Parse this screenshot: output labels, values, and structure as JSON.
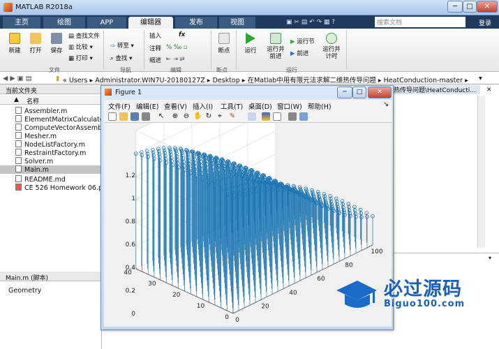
{
  "window": {
    "title": "MATLAB R2018a",
    "minimize": "─",
    "maximize": "□",
    "close": "✕"
  },
  "tabs": [
    {
      "label": "主页"
    },
    {
      "label": "绘图"
    },
    {
      "label": "APP"
    },
    {
      "label": "编辑器"
    },
    {
      "label": "发布"
    },
    {
      "label": "视图"
    }
  ],
  "search": {
    "placeholder": "搜索文档",
    "login": "登录"
  },
  "ribbon": {
    "file": {
      "new": "新建",
      "open": "打开",
      "save": "保存",
      "find_files": "查找文件",
      "compare": "比较",
      "print": "打印",
      "group": "文件"
    },
    "nav": {
      "goto": "转至",
      "find": "查找",
      "group": "导航"
    },
    "edit": {
      "insert": "插入",
      "comment": "注释",
      "indent": "缩进",
      "fx": "fx",
      "group": "编辑"
    },
    "breakpoints": {
      "label": "断点",
      "group": "断点"
    },
    "run": {
      "run": "运行",
      "run_advance": "运行并\n前进",
      "run_section": "运行节",
      "advance": "前进",
      "run_time": "运行并\n计时",
      "group": "运行"
    }
  },
  "address": {
    "parts": [
      "Users",
      "Administrator.WIN7U-20180127Z",
      "Desktop",
      "在Matlab中用有限元法求解二维热传导问题",
      "HeatConduction-master"
    ]
  },
  "current_folder": {
    "title": "当前文件夹",
    "column": "名称",
    "files": [
      "Assembler.m",
      "ElementMatrixCalculator.m",
      "ComputeVectorAssembler.m",
      "Mesher.m",
      "NodeListFactory.m",
      "RestraintFactory.m",
      "Solver.m",
      "Main.m",
      "README.md",
      "CE 526 Homework 06.pdf"
    ],
    "selected": "Main.m"
  },
  "details": {
    "title": "Main.m  (脚本)",
    "content": "Geometry"
  },
  "editor_tab": {
    "label": "热传导问题\\HeatConducti..."
  },
  "figure": {
    "title": "Figure 1",
    "menu": [
      "文件(F)",
      "编辑(E)",
      "查看(V)",
      "插入(I)",
      "工具(T)",
      "桌面(D)",
      "窗口(W)",
      "帮助(H)"
    ]
  },
  "watermark": {
    "brand": "必过源码",
    "url": "Biguo100.com"
  },
  "chart_data": {
    "type": "scatter",
    "style": "3D stem plot with circle markers",
    "color": "#1f77b4",
    "zlim": [
      0,
      1.2
    ],
    "zticks": [
      "0",
      "0.2",
      "0.4",
      "0.6",
      "0.8",
      "1",
      "1.2"
    ],
    "xlim": [
      0,
      100
    ],
    "xticks": [
      "0",
      "20",
      "40",
      "60",
      "80",
      "100"
    ],
    "ylim": [
      0,
      40
    ],
    "yticks": [
      "0",
      "10",
      "20",
      "30",
      "40"
    ],
    "grid": true,
    "surface_profile": {
      "x": [
        0,
        10,
        20,
        30,
        40,
        50,
        60,
        70,
        80,
        90,
        100
      ],
      "z_at_y0": [
        1.0,
        0.98,
        0.95,
        0.9,
        0.82,
        0.72,
        0.6,
        0.48,
        0.38,
        0.3,
        0.25
      ]
    }
  }
}
